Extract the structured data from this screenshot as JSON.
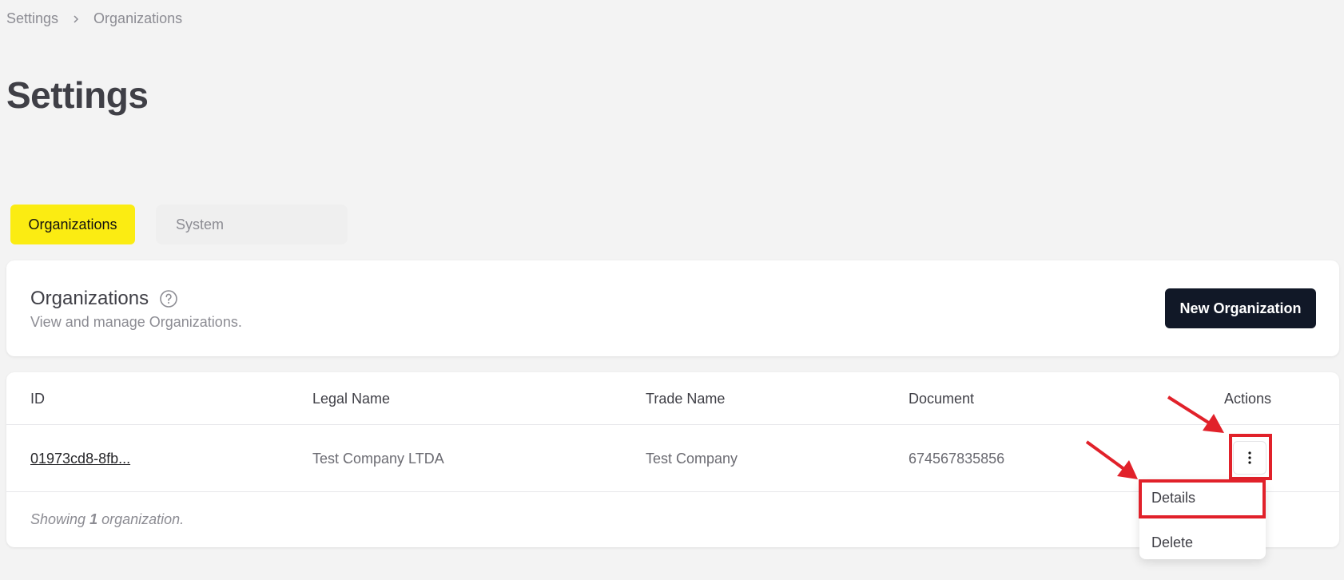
{
  "breadcrumb": {
    "root": "Settings",
    "current": "Organizations"
  },
  "page": {
    "title": "Settings"
  },
  "tabs": [
    {
      "label": "Organizations",
      "active": true
    },
    {
      "label": "System",
      "active": false
    }
  ],
  "header_card": {
    "title": "Organizations",
    "subtitle": "View and manage Organizations.",
    "new_button": "New Organization"
  },
  "table": {
    "columns": [
      "ID",
      "Legal Name",
      "Trade Name",
      "Document",
      "Actions"
    ],
    "rows": [
      {
        "id": "01973cd8-8fb...",
        "legal_name": "Test Company LTDA",
        "trade_name": "Test Company",
        "document": "674567835856"
      }
    ],
    "footer": {
      "prefix": "Showing",
      "count": "1",
      "suffix": "organization."
    }
  },
  "actions_menu": {
    "items": [
      "Details",
      "Delete"
    ]
  },
  "colors": {
    "accent_tab": "#fbec12",
    "primary_button": "#111827",
    "annotation": "#e1212a"
  },
  "icons": {
    "breadcrumb_separator": "chevron-right-icon",
    "help": "question-circle-icon",
    "row_actions": "more-vertical-icon"
  }
}
